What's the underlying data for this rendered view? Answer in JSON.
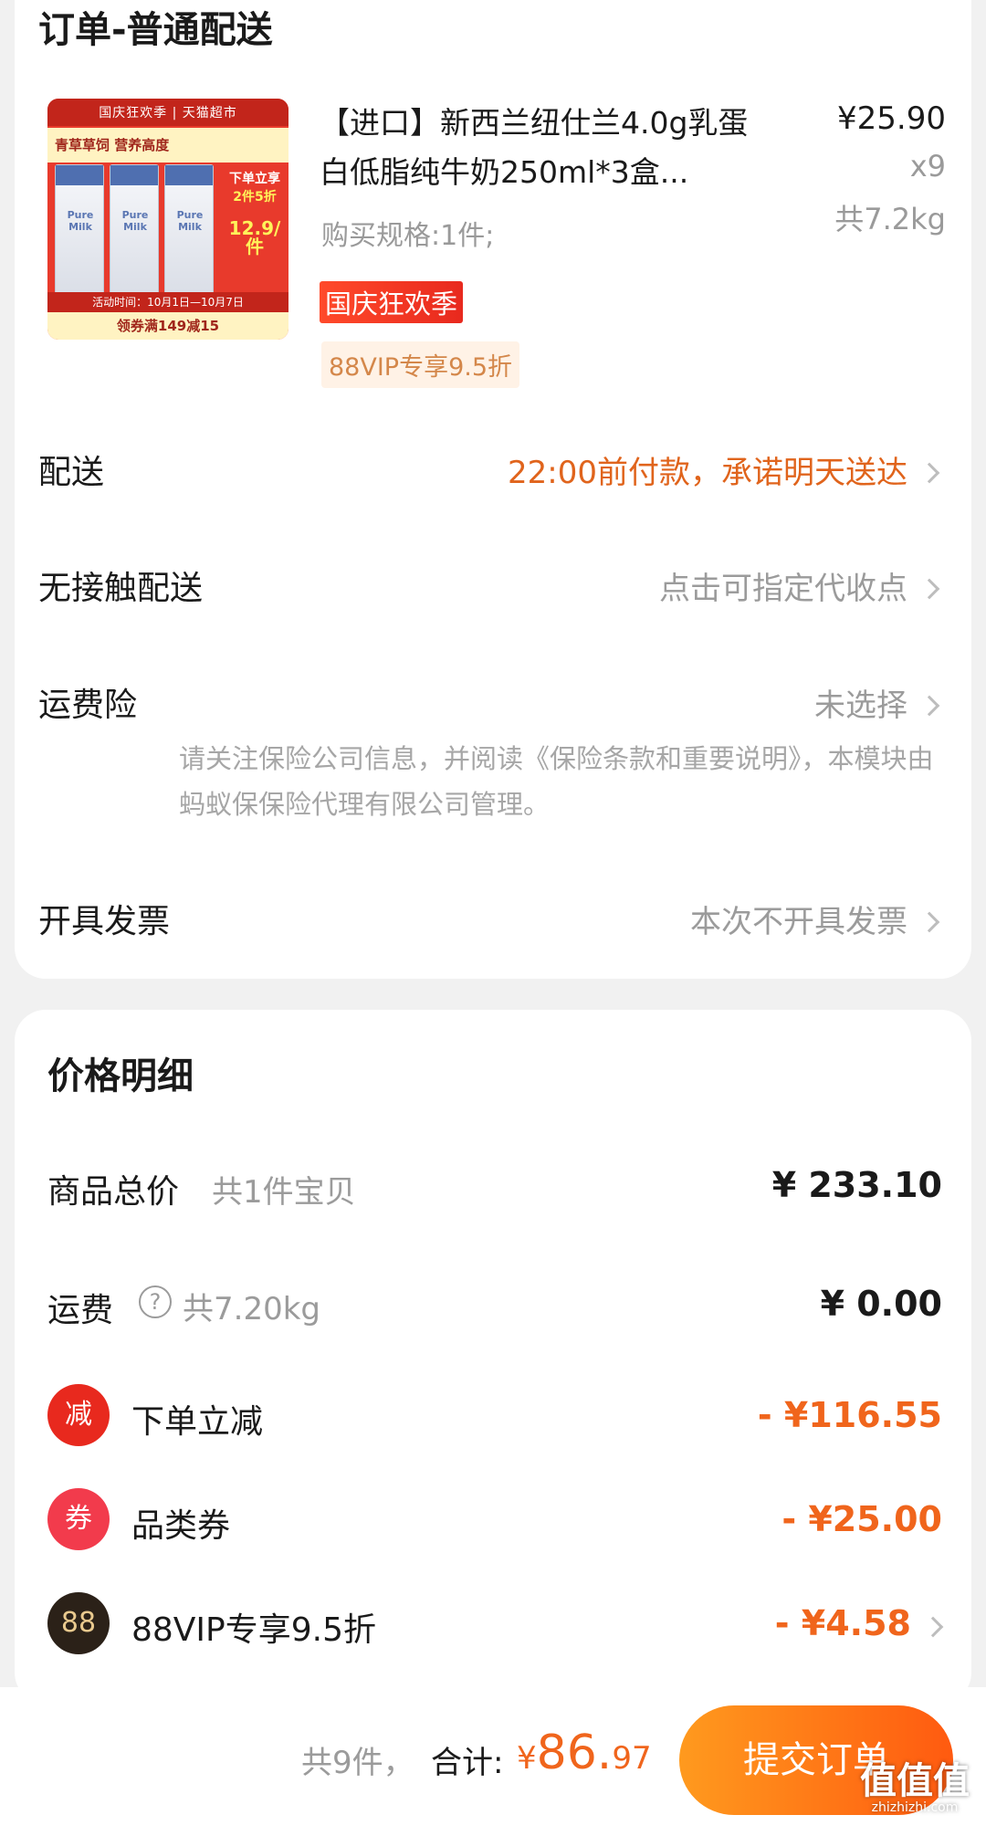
{
  "order": {
    "section_title": "订单-普通配送",
    "product": {
      "thumb_top": "国庆狂欢季 | 天猫超市",
      "thumb_band": "青草草饲 营养高度",
      "thumb_carton_text": "Pure Milk",
      "thumb_promo_line1": "下单立享",
      "thumb_promo_line2": "2件5折",
      "thumb_promo_price": "12.9/件",
      "thumb_bottom1": "活动时间：10月1日—10月7日",
      "thumb_bottom2": "领券满149减15",
      "title": "【进口】新西兰纽仕兰4.0g乳蛋白低脂纯牛奶250ml*3盒...",
      "price": "¥25.90",
      "quantity": "x9",
      "weight": "共7.2kg",
      "spec": "购买规格:1件;",
      "tag_festival": "国庆狂欢季",
      "tag_vip": "88VIP专享9.5折"
    },
    "rows": {
      "delivery_label": "配送",
      "delivery_value": "22:00前付款，承诺明天送达",
      "contactless_label": "无接触配送",
      "contactless_value": "点击可指定代收点",
      "insurance_label": "运费险",
      "insurance_value": "未选择",
      "insurance_note": "请关注保险公司信息，并阅读《保险条款和重要说明》，本模块由蚂蚁保保险代理有限公司管理。",
      "invoice_label": "开具发票",
      "invoice_value": "本次不开具发票"
    }
  },
  "price_detail": {
    "section_title": "价格明细",
    "goods_total_label": "商品总价",
    "goods_total_sub": "共1件宝贝",
    "goods_total_value": "¥ 233.10",
    "shipping_label": "运费",
    "shipping_help": "?",
    "shipping_sub": "共7.20kg",
    "shipping_value": "¥ 0.00",
    "discounts": [
      {
        "icon": "减",
        "label": "下单立减",
        "value": "- ¥116.55",
        "color": "#e8291e"
      },
      {
        "icon": "券",
        "label": "品类券",
        "value": "- ¥25.00",
        "color": "#f23b4c"
      },
      {
        "icon": "88",
        "label": "88VIP专享9.5折",
        "value": "- ¥4.58",
        "color": "#2b2118"
      }
    ]
  },
  "footer": {
    "count": "共9件，",
    "total_label": "合计:",
    "currency": "¥",
    "total_int": "86.",
    "total_dec": "97",
    "submit": "提交订单",
    "watermark": "值值值",
    "watermark_url": "zhizhizhi.com"
  },
  "colors": {
    "accent_orange": "#f0651c",
    "delivery_orange": "#e0641c",
    "button_gradient_start": "#ff9a1e",
    "button_gradient_end": "#ff5a10"
  }
}
